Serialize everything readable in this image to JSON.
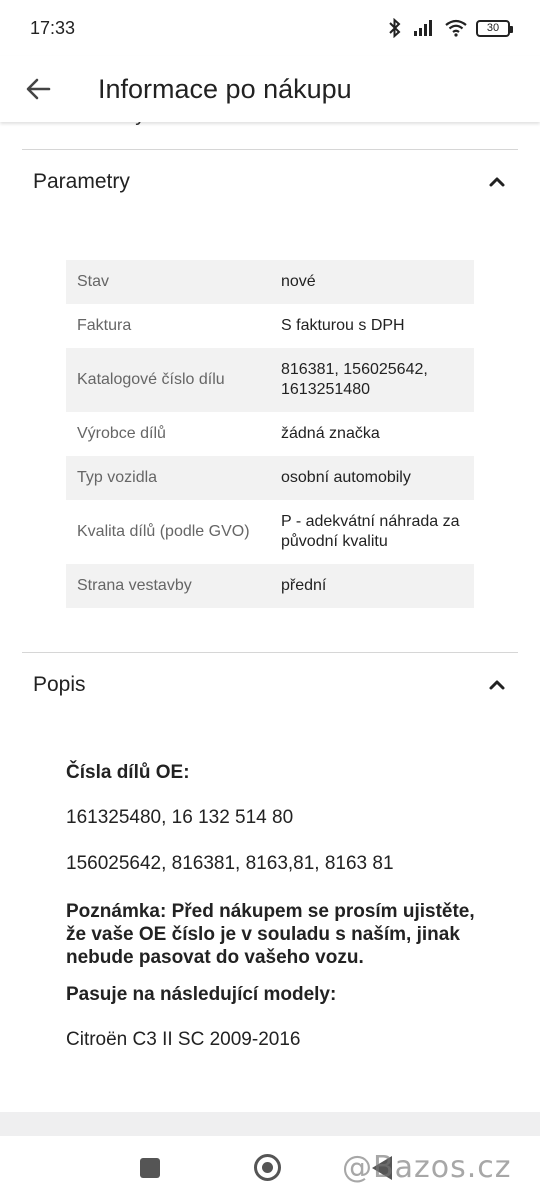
{
  "status_bar": {
    "time": "17:33",
    "battery": "30",
    "icons": [
      "bluetooth-icon",
      "signal-icon",
      "wifi-icon",
      "battery-icon"
    ]
  },
  "app_bar": {
    "title": "Informace po nákupu",
    "back_icon": "arrow-back-icon"
  },
  "cut_off_text": "Pro... záruky",
  "parametry": {
    "title": "Parametry",
    "rows": [
      {
        "label": "Stav",
        "value": "nové"
      },
      {
        "label": "Faktura",
        "value": "S fakturou s DPH"
      },
      {
        "label": "Katalogové číslo dílu",
        "value": "816381, 156025642, 1613251480"
      },
      {
        "label": "Výrobce dílů",
        "value": "žádná značka"
      },
      {
        "label": "Typ vozidla",
        "value": "osobní automobily"
      },
      {
        "label": "Kvalita dílů (podle GVO)",
        "value": "P - adekvátní náhrada za původní kvalitu"
      },
      {
        "label": "Strana vestavby",
        "value": "přední"
      }
    ]
  },
  "popis": {
    "title": "Popis",
    "heading": "Čísla dílů OE:",
    "line1": "161325480, 16 132 514 80",
    "line2": "156025642, 816381, 8163,81, 8163 81",
    "note": "Poznámka: Před nákupem se prosím ujistěte, že vaše OE číslo je v souladu s naším, jinak nebude pasovat do vašeho vozu.",
    "models_heading": "Pasuje na následující modely:",
    "models": "Citroën C3 II SC 2009-2016"
  },
  "watermark": "@Bazos.cz"
}
